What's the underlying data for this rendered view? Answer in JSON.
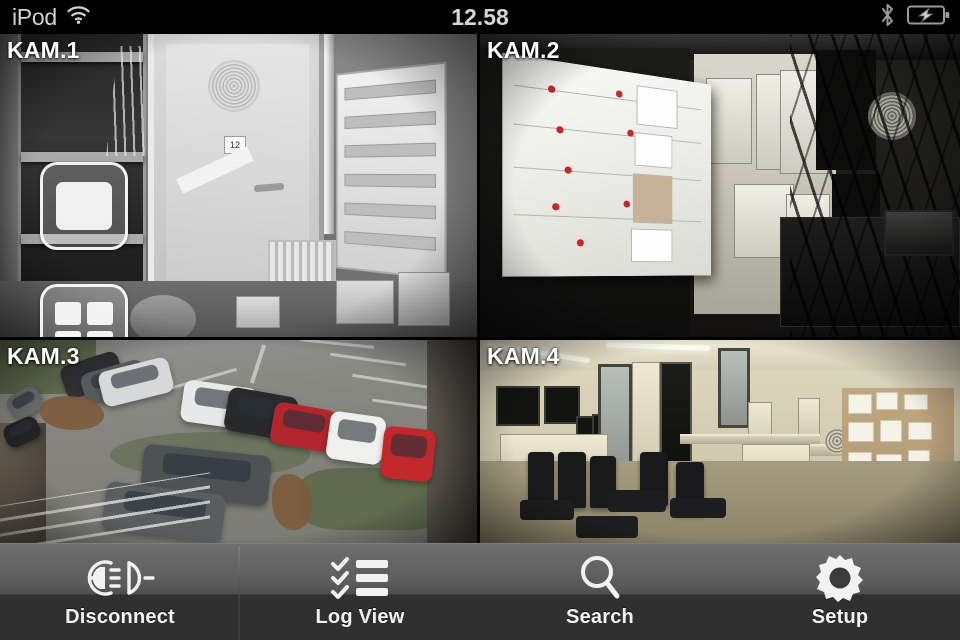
{
  "status_bar": {
    "carrier": "iPod",
    "wifi_icon": "wifi-icon",
    "time": "12.58",
    "bluetooth_icon": "bluetooth-icon",
    "battery_icon": "battery-charging-icon"
  },
  "view_controls": {
    "single_view_label": "single-view",
    "quad_view_label": "quad-view"
  },
  "cameras": [
    {
      "id": "cam1",
      "label": "KAM.1",
      "scene": "grayscale server-room door and rack"
    },
    {
      "id": "cam2",
      "label": "KAM.2",
      "scene": "dark office corridor with whiteboard"
    },
    {
      "id": "cam3",
      "label": "KAM.3",
      "scene": "outdoor car park with parked cars"
    },
    {
      "id": "cam4",
      "label": "KAM.4",
      "scene": "lab room with chairs and workbenches"
    }
  ],
  "toolbar": {
    "items": [
      {
        "label": "Disconnect",
        "icon": "disconnect-plug-icon"
      },
      {
        "label": "Log View",
        "icon": "checklist-icon"
      },
      {
        "label": "Search",
        "icon": "magnifier-icon"
      },
      {
        "label": "Setup",
        "icon": "gear-icon"
      }
    ]
  },
  "colors": {
    "status_bar_bg": "#000000",
    "status_text": "#d2d2d2",
    "toolbar_top": "#6e6e6e",
    "toolbar_bottom": "#2f2f2f",
    "label_text": "#ffffff"
  }
}
